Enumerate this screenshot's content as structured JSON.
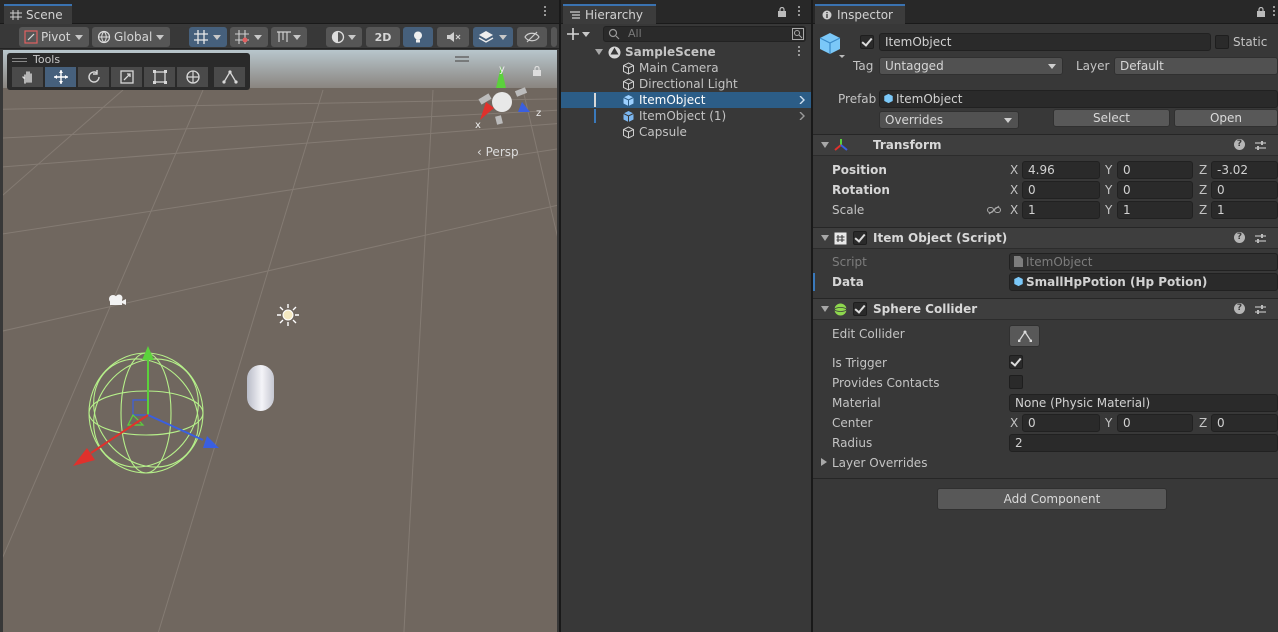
{
  "scene": {
    "tab_label": "Scene",
    "pivot_label": "Pivot",
    "global_label": "Global",
    "mode_2d_label": "2D",
    "tools_title": "Tools",
    "persp_label": "Persp",
    "gizmo_x": "x",
    "gizmo_y": "y",
    "gizmo_z": "z"
  },
  "hierarchy": {
    "tab_label": "Hierarchy",
    "search_placeholder": "All",
    "scene_name": "SampleScene",
    "items": [
      {
        "label": "Main Camera"
      },
      {
        "label": "Directional Light"
      },
      {
        "label": "ItemObject"
      },
      {
        "label": "ItemObject (1)"
      },
      {
        "label": "Capsule"
      }
    ]
  },
  "inspector": {
    "tab_label": "Inspector",
    "object_name": "ItemObject",
    "static_label": "Static",
    "tag_label": "Tag",
    "tag_value": "Untagged",
    "layer_label": "Layer",
    "layer_value": "Default",
    "prefab_label": "Prefab",
    "prefab_value": "ItemObject",
    "overrides_label": "Overrides",
    "select_label": "Select",
    "open_label": "Open",
    "transform": {
      "title": "Transform",
      "position_label": "Position",
      "rotation_label": "Rotation",
      "scale_label": "Scale",
      "position": {
        "x": "4.96",
        "y": "0",
        "z": "-3.02"
      },
      "rotation": {
        "x": "0",
        "y": "0",
        "z": "0"
      },
      "scale": {
        "x": "1",
        "y": "1",
        "z": "1"
      },
      "axis_x": "X",
      "axis_y": "Y",
      "axis_z": "Z"
    },
    "script_component": {
      "title": "Item Object (Script)",
      "script_label": "Script",
      "script_value": "ItemObject",
      "data_label": "Data",
      "data_value": "SmallHpPotion (Hp Potion)"
    },
    "sphere_collider": {
      "title": "Sphere Collider",
      "edit_collider_label": "Edit Collider",
      "is_trigger_label": "Is Trigger",
      "is_trigger": true,
      "provides_contacts_label": "Provides Contacts",
      "provides_contacts": false,
      "material_label": "Material",
      "material_value": "None (Physic Material)",
      "center_label": "Center",
      "center": {
        "x": "0",
        "y": "0",
        "z": "0"
      },
      "radius_label": "Radius",
      "radius_value": "2",
      "layer_overrides_label": "Layer Overrides"
    },
    "add_component_label": "Add Component"
  },
  "colors": {
    "accent_blue": "#3a72b0",
    "selection": "#2c5d87",
    "prefab_blue": "#7bb6f0",
    "axis_red": "#e0312c",
    "axis_green": "#5bd13c",
    "axis_blue": "#3a5fe0"
  }
}
